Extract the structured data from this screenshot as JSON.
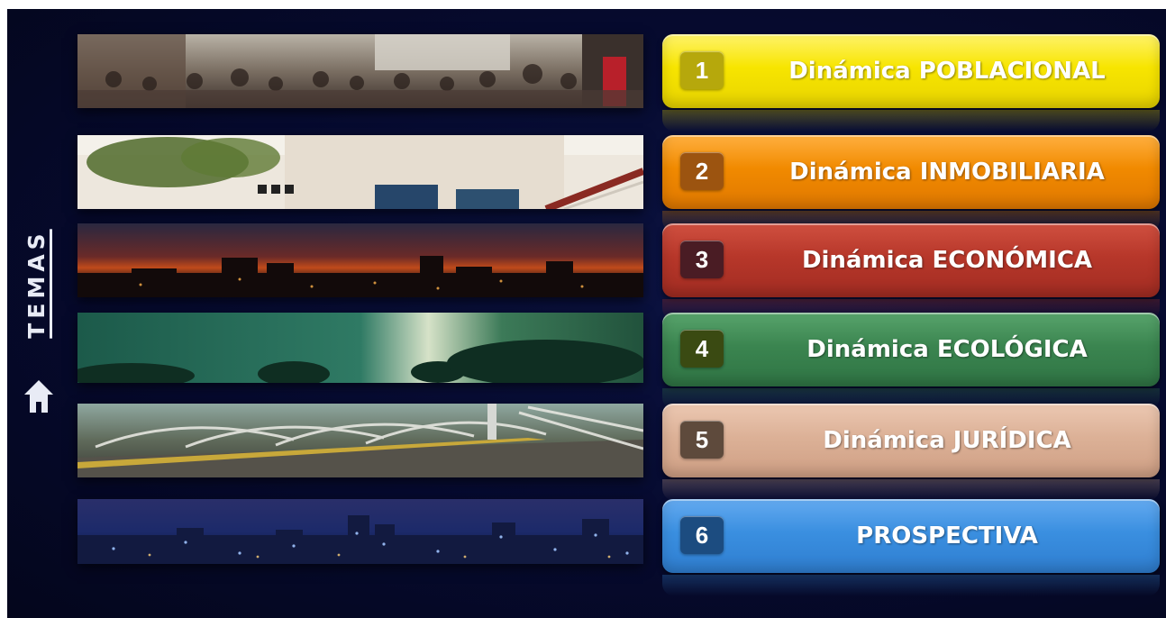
{
  "sidebar": {
    "label": "TEMAS",
    "home_icon": "home-icon"
  },
  "colors": {
    "background": "#060a2e",
    "topic_1": "#f7e500",
    "topic_2": "#f18a00",
    "topic_3": "#b7372a",
    "topic_4": "#3b8550",
    "topic_5": "#dcb197",
    "topic_6": "#3a8fe0"
  },
  "topics": [
    {
      "number": "1",
      "label": "Dinámica POBLACIONAL",
      "image": "crowd-street-photo"
    },
    {
      "number": "2",
      "label": "Dinámica INMOBILIARIA",
      "image": "building-photo"
    },
    {
      "number": "3",
      "label": "Dinámica ECONÓMICA",
      "image": "city-sunset-photo"
    },
    {
      "number": "4",
      "label": "Dinámica ECOLÓGICA",
      "image": "forest-mist-photo"
    },
    {
      "number": "5",
      "label": "Dinámica JURÍDICA",
      "image": "bridge-photo"
    },
    {
      "number": "6",
      "label": "PROSPECTIVA",
      "image": "night-skyline-photo"
    }
  ]
}
